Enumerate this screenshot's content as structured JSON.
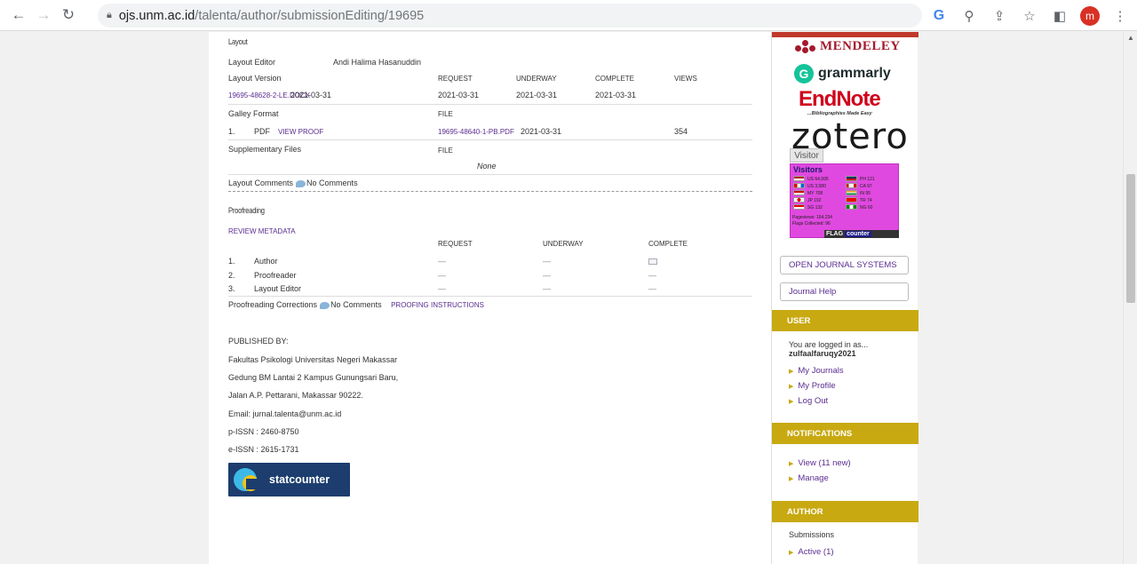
{
  "browser": {
    "url_host": "ojs.unm.ac.id",
    "url_path": "/talenta/author/submissionEditing/19695",
    "avatar_letter": "m"
  },
  "layout": {
    "title": "Layout",
    "editor_label": "Layout Editor",
    "editor_name": "Andi Halima Hasanuddin",
    "version_label": "Layout Version",
    "headers": {
      "request": "REQUEST",
      "underway": "UNDERWAY",
      "complete": "COMPLETE",
      "views": "VIEWS"
    },
    "version_file": "19695-48628-2-LE.DOCX",
    "version_date": "2021-03-31",
    "version_request": "2021-03-31",
    "version_underway": "2021-03-31",
    "version_complete": "2021-03-31",
    "galley_label": "Galley Format",
    "file_header": "FILE",
    "galley_num": "1.",
    "galley_type": "PDF",
    "view_proof": "VIEW PROOF",
    "galley_file": "19695-48640-1-PB.PDF",
    "galley_date": "2021-03-31",
    "galley_views": "354",
    "supp_label": "Supplementary Files",
    "supp_none": "None",
    "comments_label": "Layout Comments",
    "comments_value": "No Comments"
  },
  "proofreading": {
    "title": "Proofreading",
    "review_metadata": "REVIEW METADATA",
    "headers": {
      "request": "REQUEST",
      "underway": "UNDERWAY",
      "complete": "COMPLETE"
    },
    "rows": [
      {
        "num": "1.",
        "role": "Author",
        "request": "—",
        "underway": "—",
        "complete": ""
      },
      {
        "num": "2.",
        "role": "Proofreader",
        "request": "—",
        "underway": "—",
        "complete": "—"
      },
      {
        "num": "3.",
        "role": "Layout Editor",
        "request": "—",
        "underway": "—",
        "complete": "—"
      }
    ],
    "corrections_label": "Proofreading Corrections",
    "corrections_value": "No Comments",
    "instructions": "PROOFING INSTRUCTIONS"
  },
  "publisher": {
    "published_by": "PUBLISHED BY:",
    "line1": "Fakultas Psikologi Universitas Negeri Makassar",
    "line2": "Gedung BM Lantai 2 Kampus Gunungsari Baru,",
    "line3": "Jalan A.P. Pettarani, Makassar 90222.",
    "email": "Email: jurnal.talenta@unm.ac.id",
    "pissn": "p-ISSN : 2460-8750",
    "eissn": "e-ISSN : 2615-1731",
    "statcounter": "statcounter"
  },
  "sidebar": {
    "mendeley": "MENDELEY",
    "grammarly": "grammarly",
    "endnote": "EndNote",
    "endnote_tag": "...Bibliographies Made Easy",
    "zotero": "zotero",
    "visitor": "Visitor",
    "flag_counter": {
      "title": "Visitors",
      "left": [
        {
          "code": "US",
          "count": "64,995"
        },
        {
          "code": "US",
          "count": "3,580"
        },
        {
          "code": "MY",
          "count": "708"
        },
        {
          "code": "JP",
          "count": "192"
        },
        {
          "code": "SG",
          "count": "132"
        }
      ],
      "right": [
        {
          "code": "PH",
          "count": "121"
        },
        {
          "code": "CA",
          "count": "97"
        },
        {
          "code": "IN",
          "count": "95"
        },
        {
          "code": "TR",
          "count": "74"
        },
        {
          "code": "NG",
          "count": "60"
        }
      ],
      "pageviews": "Pageviews: 164,234",
      "flags": "Flags Collected: 96",
      "logo": "FLAG",
      "logo2": "counter"
    },
    "ojs_button": "OPEN JOURNAL SYSTEMS",
    "help_button": "Journal Help",
    "user_head": "USER",
    "logged_in": "You are logged in as...",
    "username": "zulfaalfaruqy2021",
    "user_links": [
      "My Journals",
      "My Profile",
      "Log Out"
    ],
    "notif_head": "NOTIFICATIONS",
    "notif_links": [
      "View (11 new)",
      "Manage"
    ],
    "author_head": "AUTHOR",
    "submissions": "Submissions",
    "active": "Active (1)"
  },
  "colors": {
    "link": "#5a2d91",
    "sidebar_head": "#c8a911",
    "mendeley": "#a5192e",
    "endnote": "#d0021b",
    "flag_counter_bg": "#e049e0"
  }
}
